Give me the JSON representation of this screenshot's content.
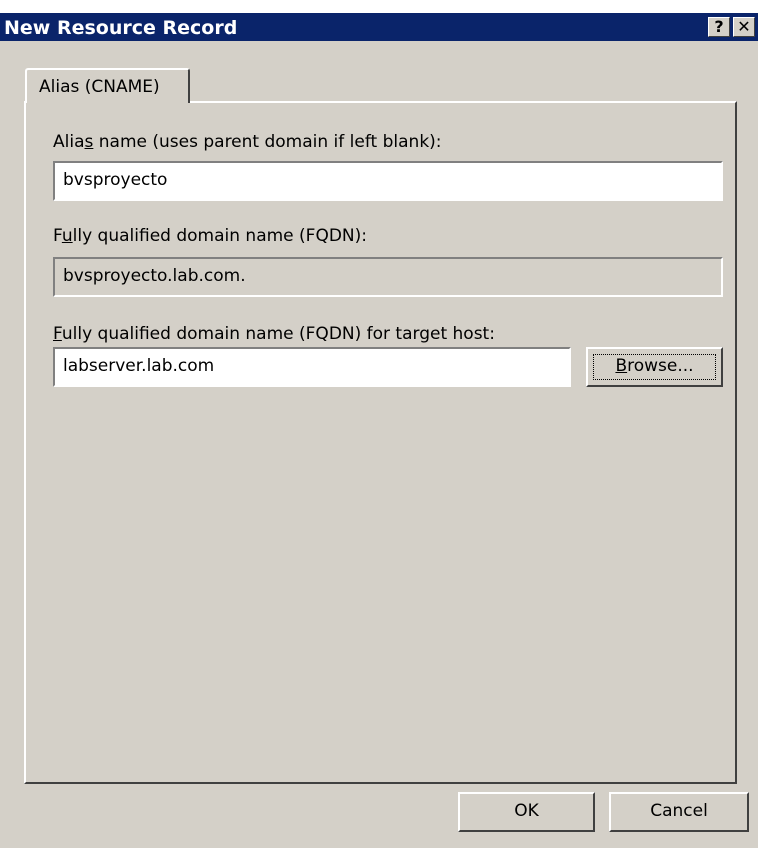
{
  "window": {
    "title": "New Resource Record",
    "help_glyph": "?",
    "close_glyph": "✕"
  },
  "tabs": [
    {
      "label": "Alias (CNAME)"
    }
  ],
  "form": {
    "alias_label_pre": "Alia",
    "alias_label_accel": "s",
    "alias_label_post": " name (uses parent domain if left blank):",
    "alias_value": "bvsproyecto",
    "fqdn_label_pre": "F",
    "fqdn_label_accel": "u",
    "fqdn_label_post": "lly qualified domain name (FQDN):",
    "fqdn_value": "bvsproyecto.lab.com.",
    "target_label_accel": "F",
    "target_label_post": "ully qualified domain name (FQDN) for target host:",
    "target_value": "labserver.lab.com",
    "browse_accel": "B",
    "browse_post": "rowse..."
  },
  "buttons": {
    "ok": "OK",
    "cancel": "Cancel"
  }
}
